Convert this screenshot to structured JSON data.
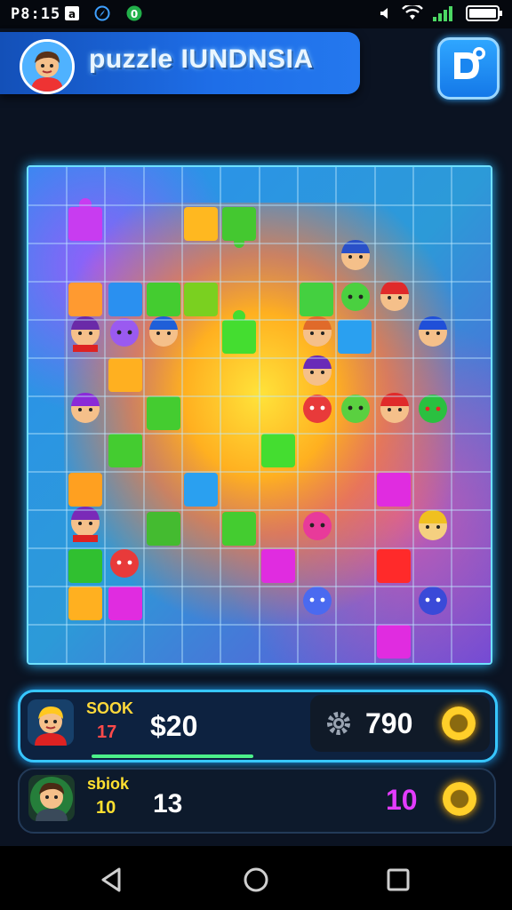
{
  "status_bar": {
    "time": "P8:15",
    "icons": [
      "notification-icon",
      "compass-icon",
      "app-icon",
      "volume-icon",
      "wifi-icon",
      "signal-icon",
      "battery-icon"
    ]
  },
  "header": {
    "title": "puzzle IUNDNSIA",
    "accent": "#1e6ee8",
    "corner_button_icon": "puzzle-logo-icon"
  },
  "board": {
    "columns": 12,
    "rows": 13,
    "glow_color": "#6fe0ff"
  },
  "player_panel": {
    "name": "SOOK",
    "level": "17",
    "score": "$20",
    "coins": "790",
    "coin_icon": "gear-icon",
    "progress_percent": 35
  },
  "opponent_panel": {
    "name": "sbiok",
    "level": "10",
    "score": "13",
    "coins": "10",
    "coin_icon": "gear-icon"
  },
  "navbar": {
    "buttons": [
      "back-icon",
      "home-icon",
      "recents-icon"
    ]
  }
}
